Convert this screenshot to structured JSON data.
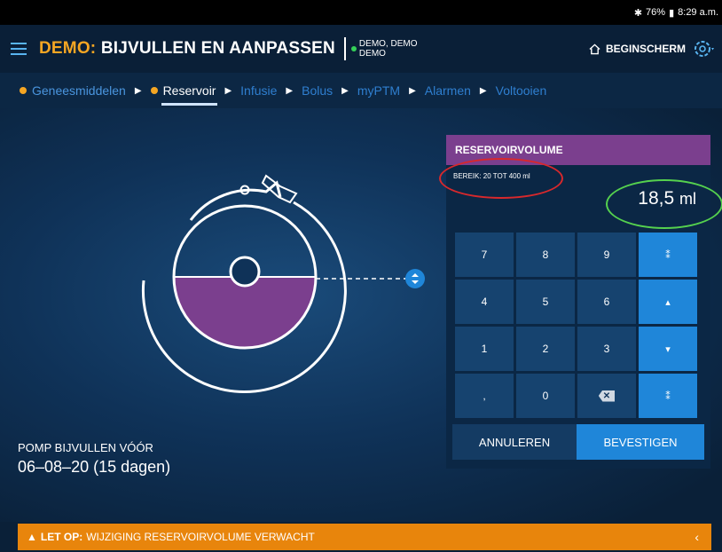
{
  "status_bar": {
    "battery": "76%",
    "time": "8:29 a.m."
  },
  "header": {
    "title_prefix": "DEMO:",
    "title_main": "BIJVULLEN EN AANPASSEN",
    "user_line1": "DEMO, DEMO",
    "user_line2": "DEMO",
    "home_label": "BEGINSCHERM"
  },
  "breadcrumb": [
    {
      "label": "Geneesmiddelen",
      "state": "done"
    },
    {
      "label": "Reservoir",
      "state": "active"
    },
    {
      "label": "Infusie",
      "state": "todo"
    },
    {
      "label": "Bolus",
      "state": "todo"
    },
    {
      "label": "myPTM",
      "state": "todo"
    },
    {
      "label": "Alarmen",
      "state": "todo"
    },
    {
      "label": "Voltooien",
      "state": "todo"
    }
  ],
  "reservoir_panel": {
    "title": "RESERVOIRVOLUME",
    "range": "BEREIK: 20 TOT 400 ml",
    "value": "18,5",
    "unit": "ml",
    "keys": [
      "7",
      "8",
      "9",
      "4",
      "5",
      "6",
      "1",
      "2",
      "3",
      ",",
      "0"
    ],
    "cancel_label": "ANNULEREN",
    "confirm_label": "BEVESTIGEN"
  },
  "refill": {
    "label": "POMP BIJVULLEN VÓÓR",
    "date": "06–08–20 (15 dagen)"
  },
  "alert": {
    "strong": "LET OP:",
    "text": "WIJZIGING RESERVOIRVOLUME VERWACHT"
  },
  "colors": {
    "accent": "#f5a623",
    "reservoir_fill": "#7b3f8e",
    "button_blue": "#1f86d9",
    "alert_bar": "#e8850c"
  }
}
